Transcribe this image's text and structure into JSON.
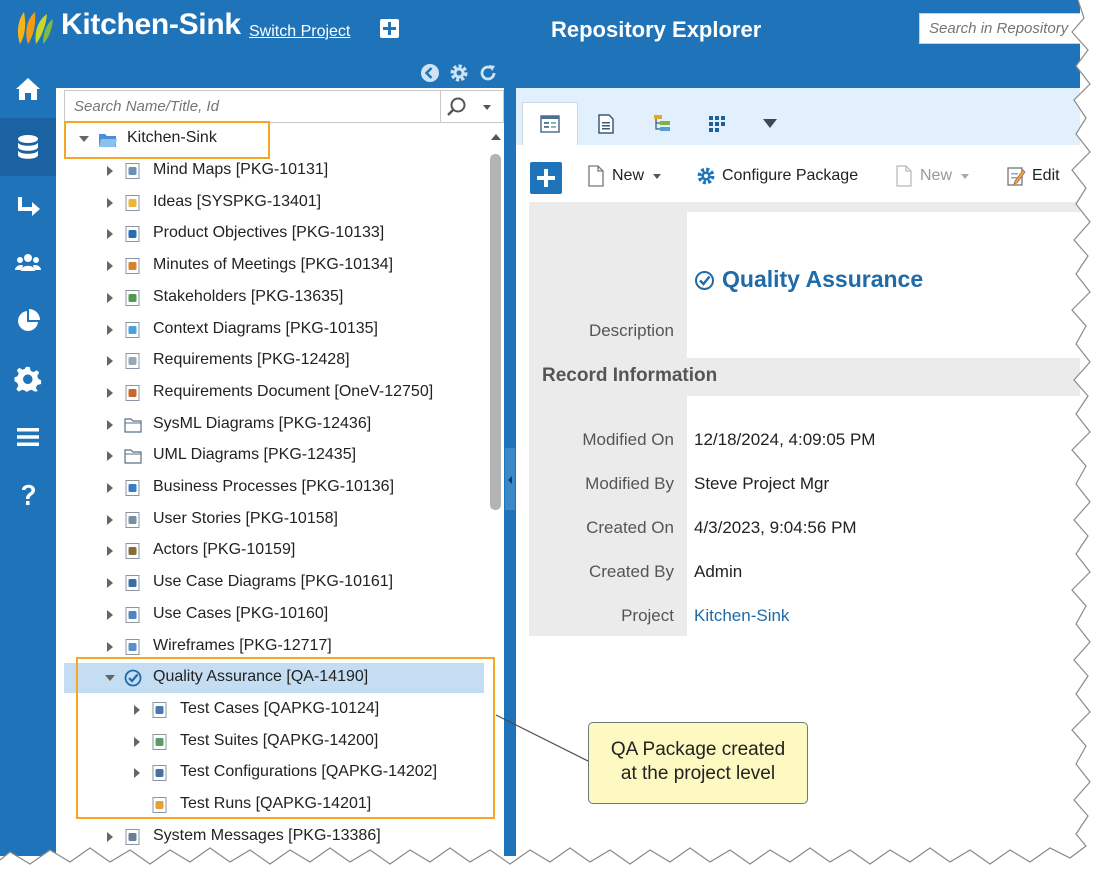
{
  "header": {
    "project_name": "Kitchen-Sink",
    "switch_project": "Switch Project",
    "page_title": "Repository Explorer",
    "search_placeholder": "Search in Repository"
  },
  "left_nav": [
    "home-icon",
    "database-icon",
    "share-arrow-icon",
    "team-icon",
    "reports-pie-icon",
    "settings-gear-icon",
    "menu-icon",
    "help-icon"
  ],
  "tree": {
    "search_placeholder": "Search Name/Title, Id",
    "root": "Kitchen-Sink",
    "items": [
      {
        "label": "Mind Maps [PKG-10131]",
        "icon": "mind-map-icon",
        "level": 1,
        "toggle": "collapsed"
      },
      {
        "label": "Ideas [SYSPKG-13401]",
        "icon": "idea-bulb-icon",
        "level": 1,
        "toggle": "collapsed"
      },
      {
        "label": "Product Objectives [PKG-10133]",
        "icon": "pushpin-icon",
        "level": 1,
        "toggle": "collapsed"
      },
      {
        "label": "Minutes of Meetings [PKG-10134]",
        "icon": "meeting-icon",
        "level": 1,
        "toggle": "collapsed"
      },
      {
        "label": "Stakeholders [PKG-13635]",
        "icon": "stakeholders-icon",
        "level": 1,
        "toggle": "collapsed"
      },
      {
        "label": "Context Diagrams [PKG-10135]",
        "icon": "context-diagram-icon",
        "level": 1,
        "toggle": "collapsed"
      },
      {
        "label": "Requirements [PKG-12428]",
        "icon": "requirements-doc-icon",
        "level": 1,
        "toggle": "collapsed"
      },
      {
        "label": "Requirements Document [OneV-12750]",
        "icon": "requirements-document-icon",
        "level": 1,
        "toggle": "collapsed"
      },
      {
        "label": "SysML Diagrams [PKG-12436]",
        "icon": "folder-icon",
        "level": 1,
        "toggle": "collapsed"
      },
      {
        "label": "UML Diagrams [PKG-12435]",
        "icon": "folder-icon",
        "level": 1,
        "toggle": "collapsed"
      },
      {
        "label": "Business Processes [PKG-10136]",
        "icon": "business-process-icon",
        "level": 1,
        "toggle": "collapsed"
      },
      {
        "label": "User Stories [PKG-10158]",
        "icon": "user-story-icon",
        "level": 1,
        "toggle": "collapsed"
      },
      {
        "label": "Actors [PKG-10159]",
        "icon": "actor-icon",
        "level": 1,
        "toggle": "collapsed"
      },
      {
        "label": "Use Case Diagrams [PKG-10161]",
        "icon": "use-case-diagram-icon",
        "level": 1,
        "toggle": "collapsed"
      },
      {
        "label": "Use Cases [PKG-10160]",
        "icon": "use-case-icon",
        "level": 1,
        "toggle": "collapsed"
      },
      {
        "label": "Wireframes [PKG-12717]",
        "icon": "wireframe-icon",
        "level": 1,
        "toggle": "collapsed"
      },
      {
        "label": "Quality Assurance [QA-14190]",
        "icon": "quality-check-icon",
        "level": 1,
        "toggle": "expanded",
        "selected": true
      },
      {
        "label": "Test Cases [QAPKG-10124]",
        "icon": "test-case-icon",
        "level": 2,
        "toggle": "collapsed"
      },
      {
        "label": "Test Suites [QAPKG-14200]",
        "icon": "test-suite-icon",
        "level": 2,
        "toggle": "collapsed"
      },
      {
        "label": "Test Configurations [QAPKG-14202]",
        "icon": "test-config-icon",
        "level": 2,
        "toggle": "collapsed"
      },
      {
        "label": "Test Runs [QAPKG-14201]",
        "icon": "test-run-icon",
        "level": 2,
        "toggle": "none"
      },
      {
        "label": "System Messages [PKG-13386]",
        "icon": "system-message-icon",
        "level": 1,
        "toggle": "collapsed"
      }
    ]
  },
  "tabs": [
    "details-tab-icon",
    "document-tab-icon",
    "hierarchy-tab-icon",
    "grid-tab-icon",
    "more-tabs-icon"
  ],
  "commands": {
    "new": "New",
    "configure": "Configure Package",
    "new_disabled": "New",
    "edit": "Edit"
  },
  "record": {
    "title": "Quality Assurance",
    "description_label": "Description",
    "section_heading": "Record Information",
    "fields": [
      {
        "label": "Modified On",
        "value": "12/18/2024, 4:09:05 PM"
      },
      {
        "label": "Modified By",
        "value": "Steve Project Mgr"
      },
      {
        "label": "Created On",
        "value": "4/3/2023, 9:04:56 PM"
      },
      {
        "label": "Created By",
        "value": "Admin"
      },
      {
        "label": "Project",
        "value": "Kitchen-Sink"
      }
    ]
  },
  "callout": {
    "line1": "QA Package created",
    "line2": "at the project level"
  },
  "colors": {
    "brand_blue": "#1f74b9",
    "selected_row": "#c5ddf2",
    "highlight_orange": "#f5a623",
    "callout_fill": "#fdf9c1",
    "link_blue": "#1f6aa8"
  }
}
